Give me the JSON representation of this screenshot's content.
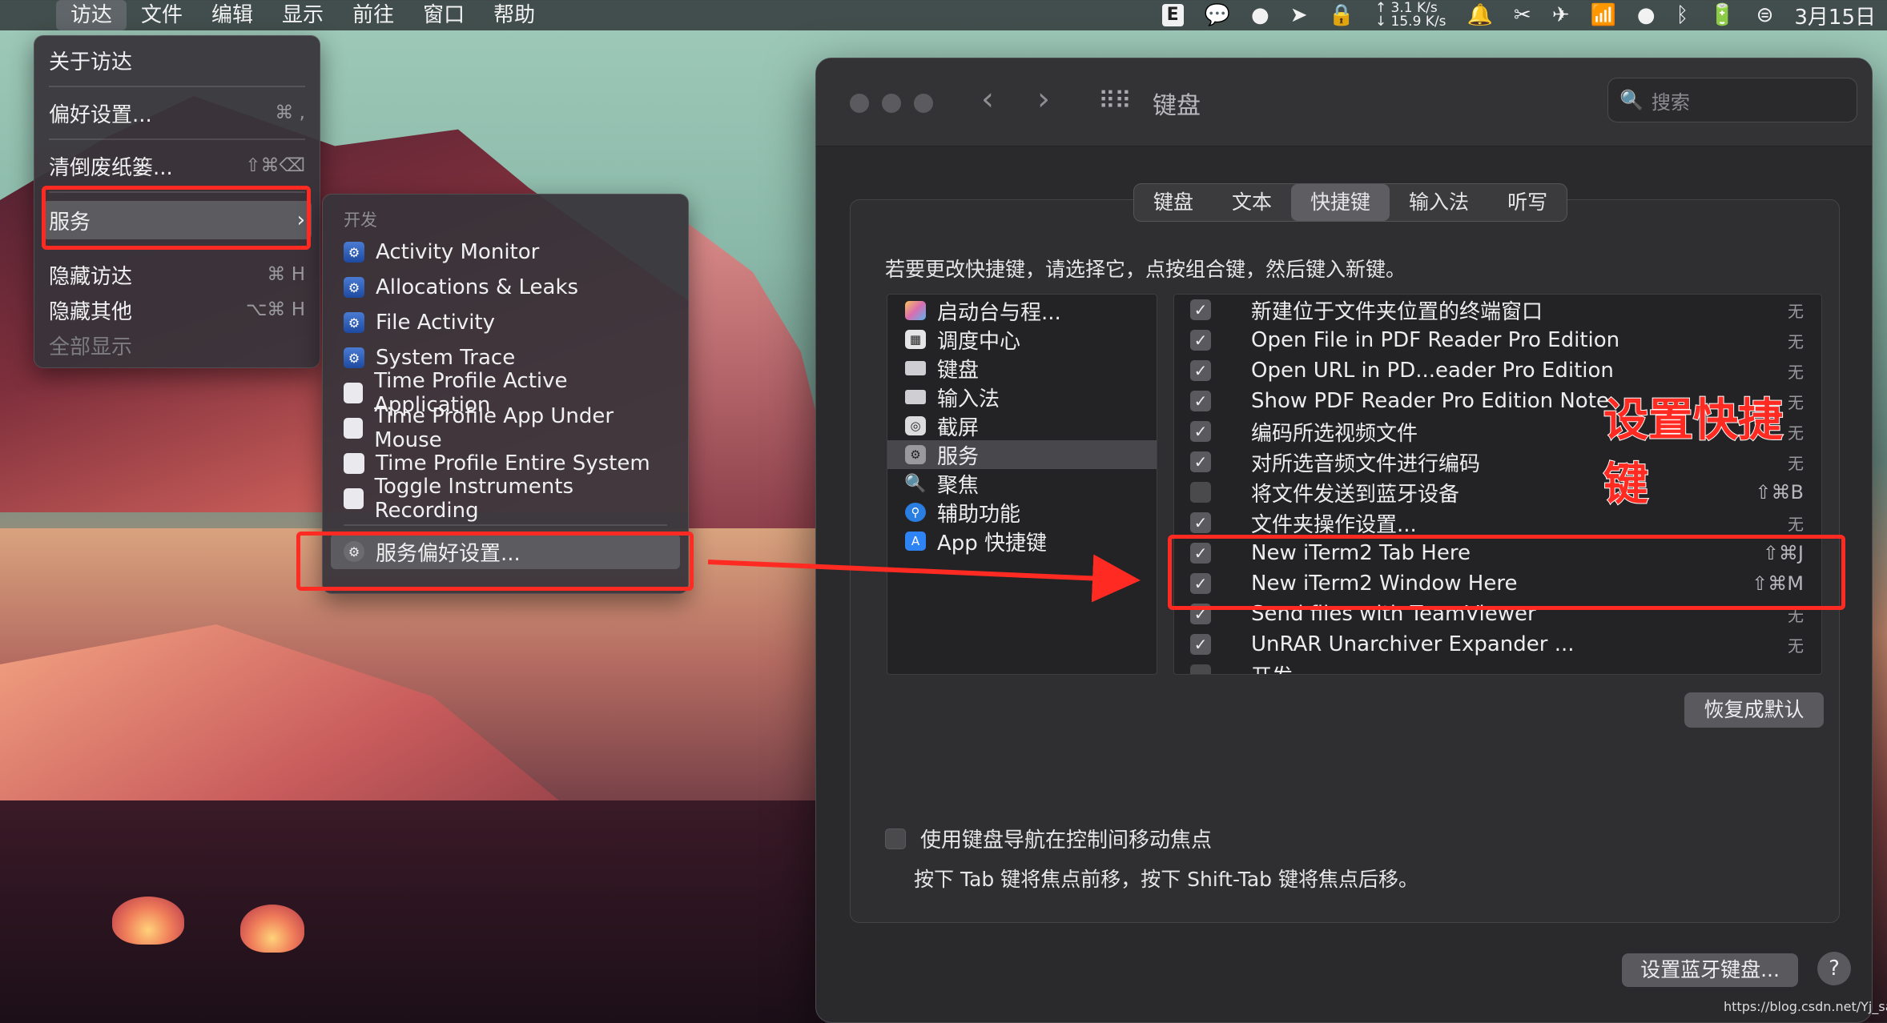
{
  "menubar": {
    "items": [
      "访达",
      "文件",
      "编辑",
      "显示",
      "前往",
      "窗口",
      "帮助"
    ],
    "status": {
      "e_icon": "E",
      "net_up": "↑ 3.1 K/s",
      "net_down": "↓ 15.9 K/s",
      "date": "3月15日"
    }
  },
  "finder_menu": {
    "about": "关于访达",
    "prefs": "偏好设置...",
    "prefs_shortcut": "⌘ ,",
    "empty_trash": "清倒废纸篓...",
    "empty_trash_shortcut": "⇧⌘⌫",
    "services": "服务",
    "hide": "隐藏访达",
    "hide_shortcut": "⌘ H",
    "hide_others": "隐藏其他",
    "hide_others_shortcut": "⌥⌘ H",
    "show_all": "全部显示"
  },
  "services_menu": {
    "header": "开发",
    "items": [
      "Activity Monitor",
      "Allocations & Leaks",
      "File Activity",
      "System Trace",
      "Time Profile Active Application",
      "Time Profile App Under Mouse",
      "Time Profile Entire System",
      "Toggle Instruments Recording"
    ],
    "prefs_item": "服务偏好设置..."
  },
  "prefs_window": {
    "title": "键盘",
    "search_placeholder": "搜索",
    "tabs": [
      "键盘",
      "文本",
      "快捷键",
      "输入法",
      "听写"
    ],
    "active_tab": "快捷键",
    "instruction": "若要更改快捷键，请选择它，点按组合键，然后键入新键。",
    "categories": [
      "启动台与程...",
      "调度中心",
      "键盘",
      "输入法",
      "截屏",
      "服务",
      "聚焦",
      "辅助功能",
      "App 快捷键"
    ],
    "selected_category": "服务",
    "shortcuts": [
      {
        "checked": true,
        "name": "新建位于文件夹位置的终端窗口",
        "key": "无"
      },
      {
        "checked": true,
        "name": "Open File in PDF Reader Pro Edition",
        "key": "无"
      },
      {
        "checked": true,
        "name": "Open URL in PD...eader Pro Edition",
        "key": "无"
      },
      {
        "checked": true,
        "name": "Show PDF Reader Pro Edition Note",
        "key": "无"
      },
      {
        "checked": true,
        "name": "编码所选视频文件",
        "key": "无"
      },
      {
        "checked": true,
        "name": "对所选音频文件进行编码",
        "key": "无"
      },
      {
        "checked": false,
        "name": "将文件发送到蓝牙设备",
        "key": "⇧⌘B"
      },
      {
        "checked": true,
        "name": "文件夹操作设置...",
        "key": "无"
      },
      {
        "checked": true,
        "name": "New iTerm2 Tab Here",
        "key": "⇧⌘J"
      },
      {
        "checked": true,
        "name": "New iTerm2 Window Here",
        "key": "⇧⌘M"
      },
      {
        "checked": true,
        "name": "Send files with TeamViewer",
        "key": "无"
      },
      {
        "checked": true,
        "name": "UnRAR Unarchiver Expander ...",
        "key": "无"
      },
      {
        "checked": false,
        "name": "开发",
        "key": ""
      }
    ],
    "restore_button": "恢复成默认",
    "kb_nav_label": "使用键盘导航在控制间移动焦点",
    "kb_nav_hint": "按下 Tab 键将焦点前移，按下 Shift-Tab 键将焦点后移。",
    "bt_button": "设置蓝牙键盘...",
    "help_button": "?"
  },
  "annotation": {
    "line1": "设置快捷",
    "line2": "键"
  },
  "watermark": "https://blog.csdn.net/Yj_sail",
  "colors": {
    "annotation_red": "#ff2a22",
    "menu_bg": "#38343a",
    "window_bg": "#2a2a2c"
  }
}
